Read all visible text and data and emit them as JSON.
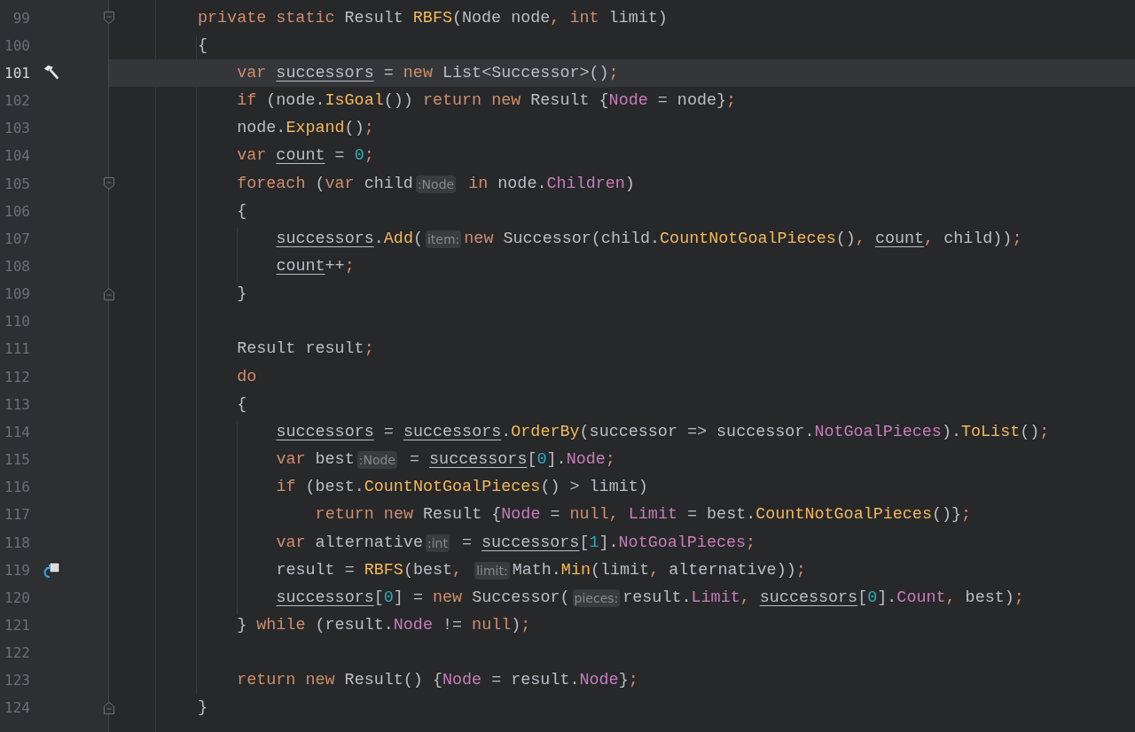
{
  "editor": {
    "lines": [
      {
        "number": "99",
        "current": false,
        "fold": {
          "kind": "start"
        },
        "tokens": [
          {
            "kind": "keyword",
            "text": "private static "
          },
          {
            "kind": "plain",
            "text": "Result "
          },
          {
            "kind": "method",
            "text": "RBFS"
          },
          {
            "kind": "plain",
            "text": "(Node node"
          },
          {
            "kind": "keyword",
            "text": ", int "
          },
          {
            "kind": "plain",
            "text": "limit)"
          }
        ]
      },
      {
        "number": "100",
        "current": false,
        "tokens": [
          {
            "kind": "plain",
            "text": "{"
          }
        ],
        "children": [
          {
            "number": "101",
            "current": true,
            "gutter": {
              "kind": "hammer"
            },
            "tokens": [
              {
                "kind": "keyword",
                "text": "var "
              },
              {
                "kind": "mutable",
                "text": "successors"
              },
              {
                "kind": "plain",
                "text": " = "
              },
              {
                "kind": "keyword",
                "text": "new "
              },
              {
                "kind": "plain",
                "text": "List<Successor>()"
              },
              {
                "kind": "keyword",
                "text": ";"
              }
            ]
          },
          {
            "number": "102",
            "current": false,
            "tokens": [
              {
                "kind": "keyword",
                "text": "if "
              },
              {
                "kind": "plain",
                "text": "(node."
              },
              {
                "kind": "method",
                "text": "IsGoal"
              },
              {
                "kind": "plain",
                "text": "()) "
              },
              {
                "kind": "keyword",
                "text": "return new "
              },
              {
                "kind": "plain",
                "text": "Result {"
              },
              {
                "kind": "member",
                "text": "Node"
              },
              {
                "kind": "plain",
                "text": " = node}"
              },
              {
                "kind": "keyword",
                "text": ";"
              }
            ]
          },
          {
            "number": "103",
            "current": false,
            "tokens": [
              {
                "kind": "plain",
                "text": "node."
              },
              {
                "kind": "method",
                "text": "Expand"
              },
              {
                "kind": "plain",
                "text": "()"
              },
              {
                "kind": "keyword",
                "text": ";"
              }
            ]
          },
          {
            "number": "104",
            "current": false,
            "tokens": [
              {
                "kind": "keyword",
                "text": "var "
              },
              {
                "kind": "mutable",
                "text": "count"
              },
              {
                "kind": "plain",
                "text": " = "
              },
              {
                "kind": "number",
                "text": "0"
              },
              {
                "kind": "keyword",
                "text": ";"
              }
            ]
          },
          {
            "number": "105",
            "current": false,
            "fold": {
              "kind": "start"
            },
            "tokens": [
              {
                "kind": "keyword",
                "text": "foreach "
              },
              {
                "kind": "plain",
                "text": "("
              },
              {
                "kind": "keyword",
                "text": "var "
              },
              {
                "kind": "plain",
                "text": "child"
              },
              {
                "kind": "hint",
                "text": ":Node"
              },
              {
                "kind": "keyword",
                "text": " in "
              },
              {
                "kind": "plain",
                "text": "node."
              },
              {
                "kind": "member",
                "text": "Children"
              },
              {
                "kind": "plain",
                "text": ")"
              }
            ]
          },
          {
            "number": "106",
            "current": false,
            "tokens": [
              {
                "kind": "plain",
                "text": "{"
              }
            ],
            "children": [
              {
                "number": "107",
                "current": false,
                "tokens": [
                  {
                    "kind": "mutable",
                    "text": "successors"
                  },
                  {
                    "kind": "plain",
                    "text": "."
                  },
                  {
                    "kind": "method",
                    "text": "Add"
                  },
                  {
                    "kind": "plain",
                    "text": "("
                  },
                  {
                    "kind": "hint",
                    "text": "item:"
                  },
                  {
                    "kind": "keyword",
                    "text": "new "
                  },
                  {
                    "kind": "plain",
                    "text": "Successor(child."
                  },
                  {
                    "kind": "method",
                    "text": "CountNotGoalPieces"
                  },
                  {
                    "kind": "plain",
                    "text": "()"
                  },
                  {
                    "kind": "keyword",
                    "text": ", "
                  },
                  {
                    "kind": "mutable",
                    "text": "count"
                  },
                  {
                    "kind": "keyword",
                    "text": ", "
                  },
                  {
                    "kind": "plain",
                    "text": "child))"
                  },
                  {
                    "kind": "keyword",
                    "text": ";"
                  }
                ]
              },
              {
                "number": "108",
                "current": false,
                "tokens": [
                  {
                    "kind": "mutable",
                    "text": "count"
                  },
                  {
                    "kind": "plain",
                    "text": "++"
                  },
                  {
                    "kind": "keyword",
                    "text": ";"
                  }
                ]
              }
            ]
          },
          {
            "number": "109",
            "current": false,
            "fold": {
              "kind": "end"
            },
            "tokens": [
              {
                "kind": "plain",
                "text": "}"
              }
            ]
          },
          {
            "number": "110",
            "current": false
          },
          {
            "number": "111",
            "current": false,
            "tokens": [
              {
                "kind": "plain",
                "text": "Result result"
              },
              {
                "kind": "keyword",
                "text": ";"
              }
            ]
          },
          {
            "number": "112",
            "current": false,
            "tokens": [
              {
                "kind": "keyword",
                "text": "do"
              }
            ]
          },
          {
            "number": "113",
            "current": false,
            "tokens": [
              {
                "kind": "plain",
                "text": "{"
              }
            ],
            "children": [
              {
                "number": "114",
                "current": false,
                "tokens": [
                  {
                    "kind": "mutable",
                    "text": "successors"
                  },
                  {
                    "kind": "plain",
                    "text": " = "
                  },
                  {
                    "kind": "mutable",
                    "text": "successors"
                  },
                  {
                    "kind": "plain",
                    "text": "."
                  },
                  {
                    "kind": "method",
                    "text": "OrderBy"
                  },
                  {
                    "kind": "plain",
                    "text": "(successor => successor."
                  },
                  {
                    "kind": "member",
                    "text": "NotGoalPieces"
                  },
                  {
                    "kind": "plain",
                    "text": ")."
                  },
                  {
                    "kind": "method",
                    "text": "ToList"
                  },
                  {
                    "kind": "plain",
                    "text": "()"
                  },
                  {
                    "kind": "keyword",
                    "text": ";"
                  }
                ]
              },
              {
                "number": "115",
                "current": false,
                "tokens": [
                  {
                    "kind": "keyword",
                    "text": "var "
                  },
                  {
                    "kind": "plain",
                    "text": "best"
                  },
                  {
                    "kind": "hint",
                    "text": ":Node"
                  },
                  {
                    "kind": "plain",
                    "text": " = "
                  },
                  {
                    "kind": "mutable",
                    "text": "successors"
                  },
                  {
                    "kind": "plain",
                    "text": "["
                  },
                  {
                    "kind": "number",
                    "text": "0"
                  },
                  {
                    "kind": "plain",
                    "text": "]."
                  },
                  {
                    "kind": "member",
                    "text": "Node"
                  },
                  {
                    "kind": "keyword",
                    "text": ";"
                  }
                ]
              },
              {
                "number": "116",
                "current": false,
                "tokens": [
                  {
                    "kind": "keyword",
                    "text": "if "
                  },
                  {
                    "kind": "plain",
                    "text": "(best."
                  },
                  {
                    "kind": "method",
                    "text": "CountNotGoalPieces"
                  },
                  {
                    "kind": "plain",
                    "text": "() > limit)"
                  }
                ],
                "children": [
                  {
                    "number": "117",
                    "current": false,
                    "tokens": [
                      {
                        "kind": "keyword",
                        "text": "return new "
                      },
                      {
                        "kind": "plain",
                        "text": "Result {"
                      },
                      {
                        "kind": "member",
                        "text": "Node"
                      },
                      {
                        "kind": "plain",
                        "text": " = "
                      },
                      {
                        "kind": "keyword",
                        "text": "null, "
                      },
                      {
                        "kind": "member",
                        "text": "Limit"
                      },
                      {
                        "kind": "plain",
                        "text": " = best."
                      },
                      {
                        "kind": "method",
                        "text": "CountNotGoalPieces"
                      },
                      {
                        "kind": "plain",
                        "text": "()}"
                      },
                      {
                        "kind": "keyword",
                        "text": ";"
                      }
                    ]
                  }
                ]
              },
              {
                "number": "118",
                "current": false,
                "tokens": [
                  {
                    "kind": "keyword",
                    "text": "var "
                  },
                  {
                    "kind": "plain",
                    "text": "alternative"
                  },
                  {
                    "kind": "hint",
                    "text": ":int"
                  },
                  {
                    "kind": "plain",
                    "text": " = "
                  },
                  {
                    "kind": "mutable",
                    "text": "successors"
                  },
                  {
                    "kind": "plain",
                    "text": "["
                  },
                  {
                    "kind": "number",
                    "text": "1"
                  },
                  {
                    "kind": "plain",
                    "text": "]."
                  },
                  {
                    "kind": "member",
                    "text": "NotGoalPieces"
                  },
                  {
                    "kind": "keyword",
                    "text": ";"
                  }
                ]
              },
              {
                "number": "119",
                "current": false,
                "gutter": {
                  "kind": "recursion"
                },
                "tokens": [
                  {
                    "kind": "plain",
                    "text": "result = "
                  },
                  {
                    "kind": "method",
                    "text": "RBFS"
                  },
                  {
                    "kind": "plain",
                    "text": "(best"
                  },
                  {
                    "kind": "keyword",
                    "text": ", "
                  },
                  {
                    "kind": "hint",
                    "text": "limit:"
                  },
                  {
                    "kind": "plain",
                    "text": "Math."
                  },
                  {
                    "kind": "method",
                    "text": "Min"
                  },
                  {
                    "kind": "plain",
                    "text": "(limit"
                  },
                  {
                    "kind": "keyword",
                    "text": ", "
                  },
                  {
                    "kind": "plain",
                    "text": "alternative))"
                  },
                  {
                    "kind": "keyword",
                    "text": ";"
                  }
                ]
              },
              {
                "number": "120",
                "current": false,
                "tokens": [
                  {
                    "kind": "mutable",
                    "text": "successors"
                  },
                  {
                    "kind": "plain",
                    "text": "["
                  },
                  {
                    "kind": "number",
                    "text": "0"
                  },
                  {
                    "kind": "plain",
                    "text": "] = "
                  },
                  {
                    "kind": "keyword",
                    "text": "new "
                  },
                  {
                    "kind": "plain",
                    "text": "Successor("
                  },
                  {
                    "kind": "hint",
                    "text": "pieces:"
                  },
                  {
                    "kind": "plain",
                    "text": "result."
                  },
                  {
                    "kind": "member",
                    "text": "Limit"
                  },
                  {
                    "kind": "keyword",
                    "text": ", "
                  },
                  {
                    "kind": "mutable",
                    "text": "successors"
                  },
                  {
                    "kind": "plain",
                    "text": "["
                  },
                  {
                    "kind": "number",
                    "text": "0"
                  },
                  {
                    "kind": "plain",
                    "text": "]."
                  },
                  {
                    "kind": "member",
                    "text": "Count"
                  },
                  {
                    "kind": "keyword",
                    "text": ", "
                  },
                  {
                    "kind": "plain",
                    "text": "best)"
                  },
                  {
                    "kind": "keyword",
                    "text": ";"
                  }
                ]
              }
            ]
          },
          {
            "number": "121",
            "current": false,
            "tokens": [
              {
                "kind": "plain",
                "text": "} "
              },
              {
                "kind": "keyword",
                "text": "while "
              },
              {
                "kind": "plain",
                "text": "(result."
              },
              {
                "kind": "member",
                "text": "Node"
              },
              {
                "kind": "plain",
                "text": " != "
              },
              {
                "kind": "keyword",
                "text": "null"
              },
              {
                "kind": "plain",
                "text": ")"
              },
              {
                "kind": "keyword",
                "text": ";"
              }
            ]
          },
          {
            "number": "122",
            "current": false
          },
          {
            "number": "123",
            "current": false,
            "tokens": [
              {
                "kind": "keyword",
                "text": "return new "
              },
              {
                "kind": "plain",
                "text": "Result() {"
              },
              {
                "kind": "member",
                "text": "Node"
              },
              {
                "kind": "plain",
                "text": " = result."
              },
              {
                "kind": "member",
                "text": "Node"
              },
              {
                "kind": "plain",
                "text": "}"
              },
              {
                "kind": "keyword",
                "text": ";"
              }
            ]
          }
        ]
      },
      {
        "number": "124",
        "current": false,
        "fold": {
          "kind": "end"
        },
        "tokens": [
          {
            "kind": "plain",
            "text": "}"
          }
        ]
      }
    ]
  }
}
